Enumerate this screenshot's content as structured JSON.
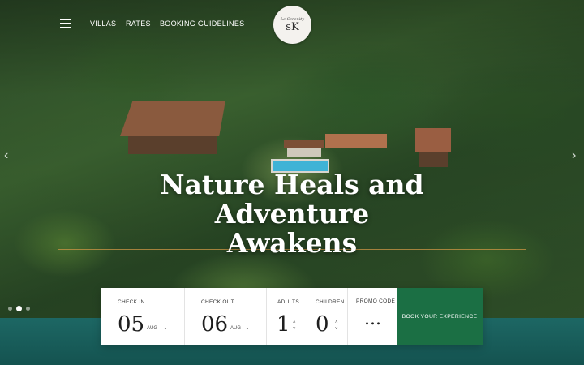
{
  "nav": {
    "links": [
      "VILLAS",
      "RATES",
      "BOOKING GUIDELINES"
    ],
    "logo": {
      "script": "Le Serenity",
      "mark": "sK",
      "sub": ""
    }
  },
  "hero": {
    "headline_line1": "Nature Heals and",
    "headline_line2": "Adventure",
    "headline_line3": "Awakens",
    "slider_total": 3,
    "slider_active": 2
  },
  "booking": {
    "check_in": {
      "label": "CHECK IN",
      "day": "05",
      "month": "AUG"
    },
    "check_out": {
      "label": "CHECK OUT",
      "day": "06",
      "month": "AUG"
    },
    "adults": {
      "label": "ADULTS",
      "value": "1"
    },
    "children": {
      "label": "CHILDREN",
      "value": "0"
    },
    "promo": {
      "label": "PROMO CODE",
      "value": "..."
    },
    "cta": "BOOK YOUR EXPERIENCE"
  },
  "icons": {
    "menu": "hamburger-icon",
    "chevron": "chevron-down-icon",
    "stepper": "stepper-arrows-icon",
    "prev": "chevron-left-icon",
    "next": "chevron-right-icon"
  },
  "colors": {
    "cta_green": "#1b6f44",
    "band_teal": "#1d6764",
    "frame_gold": "#cd9646"
  }
}
